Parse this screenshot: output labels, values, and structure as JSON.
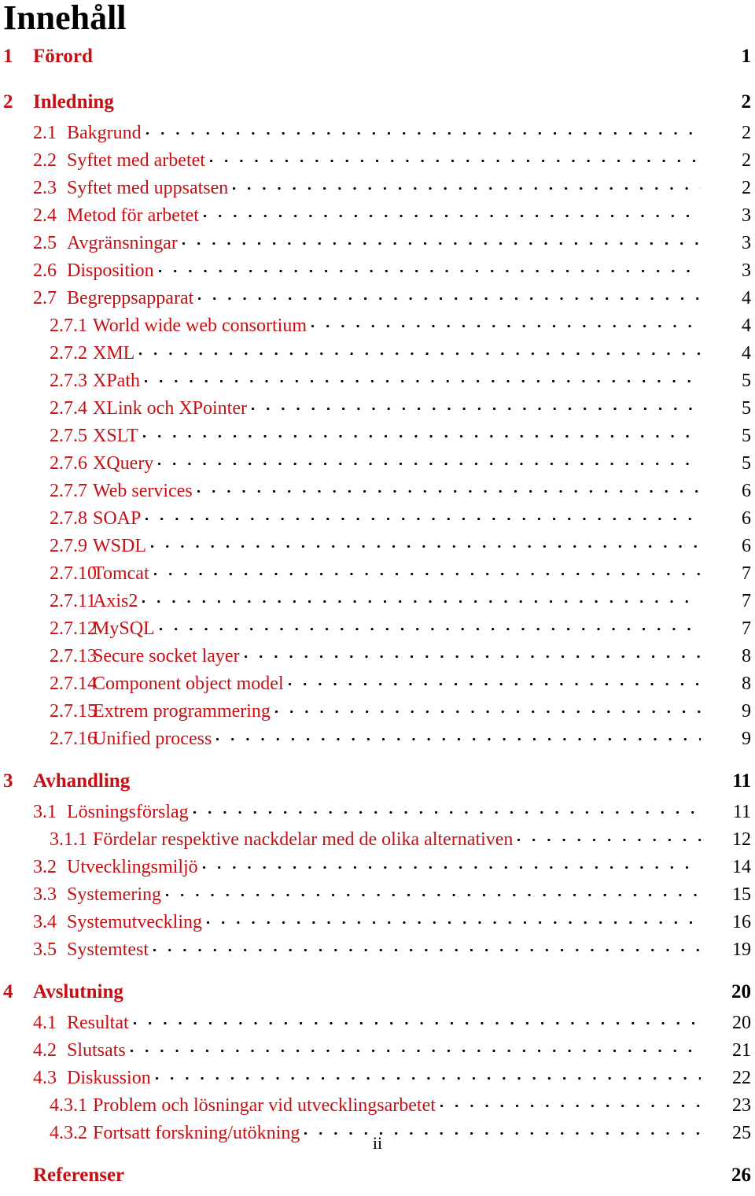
{
  "document": {
    "title": "Innehåll",
    "folio": "ii",
    "accent_color": "#C50F13",
    "text_color": "#000000"
  },
  "entries": [
    {
      "level": 1,
      "number": "1",
      "title": "Förord",
      "page": "1",
      "leader": false
    },
    {
      "level": 1,
      "number": "2",
      "title": "Inledning",
      "page": "2",
      "leader": false
    },
    {
      "level": 2,
      "number": "2.1",
      "title": "Bakgrund",
      "page": "2",
      "leader": true
    },
    {
      "level": 2,
      "number": "2.2",
      "title": "Syftet med arbetet",
      "page": "2",
      "leader": true
    },
    {
      "level": 2,
      "number": "2.3",
      "title": "Syftet med uppsatsen",
      "page": "2",
      "leader": true
    },
    {
      "level": 2,
      "number": "2.4",
      "title": "Metod för arbetet",
      "page": "3",
      "leader": true
    },
    {
      "level": 2,
      "number": "2.5",
      "title": "Avgränsningar",
      "page": "3",
      "leader": true
    },
    {
      "level": 2,
      "number": "2.6",
      "title": "Disposition",
      "page": "3",
      "leader": true
    },
    {
      "level": 2,
      "number": "2.7",
      "title": "Begreppsapparat",
      "page": "4",
      "leader": true
    },
    {
      "level": 3,
      "number": "2.7.1",
      "title": "World wide web consortium",
      "page": "4",
      "leader": true
    },
    {
      "level": 3,
      "number": "2.7.2",
      "title": "XML",
      "page": "4",
      "leader": true
    },
    {
      "level": 3,
      "number": "2.7.3",
      "title": "XPath",
      "page": "5",
      "leader": true
    },
    {
      "level": 3,
      "number": "2.7.4",
      "title": "XLink och XPointer",
      "page": "5",
      "leader": true
    },
    {
      "level": 3,
      "number": "2.7.5",
      "title": "XSLT",
      "page": "5",
      "leader": true
    },
    {
      "level": 3,
      "number": "2.7.6",
      "title": "XQuery",
      "page": "5",
      "leader": true
    },
    {
      "level": 3,
      "number": "2.7.7",
      "title": "Web services",
      "page": "6",
      "leader": true
    },
    {
      "level": 3,
      "number": "2.7.8",
      "title": "SOAP",
      "page": "6",
      "leader": true
    },
    {
      "level": 3,
      "number": "2.7.9",
      "title": "WSDL",
      "page": "6",
      "leader": true
    },
    {
      "level": 3,
      "number": "2.7.10",
      "title": "Tomcat",
      "page": "7",
      "leader": true
    },
    {
      "level": 3,
      "number": "2.7.11",
      "title": "Axis2",
      "page": "7",
      "leader": true
    },
    {
      "level": 3,
      "number": "2.7.12",
      "title": "MySQL",
      "page": "7",
      "leader": true
    },
    {
      "level": 3,
      "number": "2.7.13",
      "title": "Secure socket layer",
      "page": "8",
      "leader": true
    },
    {
      "level": 3,
      "number": "2.7.14",
      "title": "Component object model",
      "page": "8",
      "leader": true
    },
    {
      "level": 3,
      "number": "2.7.15",
      "title": "Extrem programmering",
      "page": "9",
      "leader": true
    },
    {
      "level": 3,
      "number": "2.7.16",
      "title": "Unified process",
      "page": "9",
      "leader": true
    },
    {
      "level": 1,
      "number": "3",
      "title": "Avhandling",
      "page": "11",
      "leader": false
    },
    {
      "level": 2,
      "number": "3.1",
      "title": "Lösningsförslag",
      "page": "11",
      "leader": true
    },
    {
      "level": 3,
      "number": "3.1.1",
      "title": "Fördelar respektive nackdelar med de olika alternativen",
      "page": "12",
      "leader": true
    },
    {
      "level": 2,
      "number": "3.2",
      "title": "Utvecklingsmiljö",
      "page": "14",
      "leader": true
    },
    {
      "level": 2,
      "number": "3.3",
      "title": "Systemering",
      "page": "15",
      "leader": true
    },
    {
      "level": 2,
      "number": "3.4",
      "title": "Systemutveckling",
      "page": "16",
      "leader": true
    },
    {
      "level": 2,
      "number": "3.5",
      "title": "Systemtest",
      "page": "19",
      "leader": true
    },
    {
      "level": 1,
      "number": "4",
      "title": "Avslutning",
      "page": "20",
      "leader": false
    },
    {
      "level": 2,
      "number": "4.1",
      "title": "Resultat",
      "page": "20",
      "leader": true
    },
    {
      "level": 2,
      "number": "4.2",
      "title": "Slutsats",
      "page": "21",
      "leader": true
    },
    {
      "level": 2,
      "number": "4.3",
      "title": "Diskussion",
      "page": "22",
      "leader": true
    },
    {
      "level": 3,
      "number": "4.3.1",
      "title": "Problem och lösningar vid utvecklingsarbetet",
      "page": "23",
      "leader": true
    },
    {
      "level": 3,
      "number": "4.3.2",
      "title": "Fortsatt forskning/utökning",
      "page": "25",
      "leader": true
    },
    {
      "level": 1,
      "number": "",
      "title": "Referenser",
      "page": "26",
      "leader": false
    }
  ]
}
